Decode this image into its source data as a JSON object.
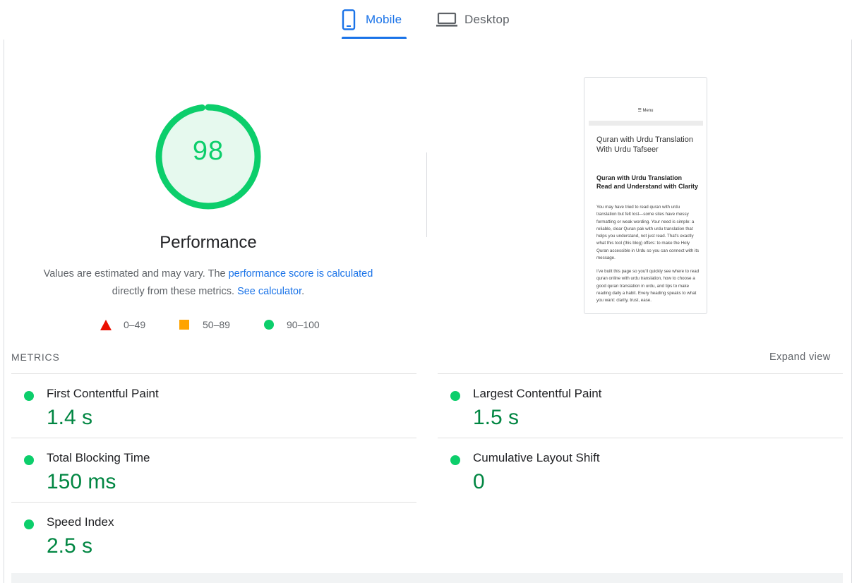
{
  "tabs": [
    {
      "label": "Mobile",
      "active": true
    },
    {
      "label": "Desktop",
      "active": false
    }
  ],
  "score": {
    "value": "98",
    "fraction": 0.98,
    "title": "Performance",
    "desc_text_1": "Values are estimated and may vary. The ",
    "desc_link_1": "performance score is calculated",
    "desc_text_2": "directly from these metrics. ",
    "desc_link_2": "See calculator",
    "desc_text_3": ".",
    "color": "#0cce6b"
  },
  "legend": {
    "fail": "0–49",
    "average": "50–89",
    "pass": "90–100"
  },
  "thumbnail": {
    "menu": "☰ Menu",
    "heading": "Quran with Urdu Translation With Urdu Tafseer",
    "subheading": "Quran with Urdu Translation Read and Understand with Clarity",
    "para1": "You may have tried to read quran with urdu translation but felt lost—some sites have messy formatting or weak wording. Your need is simple: a reliable, clear Quran pak with urdu translation that helps you understand, not just read. That's exactly what this tool (this blog) offers: to make the Holy Quran accessible in Urdu so you can connect with its message.",
    "para2": "I've built this page so you'll quickly see where to read quran online with urdu translation, how to choose a good quran translation in urdu, and tips to make reading daily a habit. Every heading speaks to what you want: clarity, trust, ease."
  },
  "metrics": {
    "title": "METRICS",
    "expand": "Expand view",
    "items": [
      {
        "label": "First Contentful Paint",
        "value": "1.4 s"
      },
      {
        "label": "Largest Contentful Paint",
        "value": "1.5 s"
      },
      {
        "label": "Total Blocking Time",
        "value": "150 ms"
      },
      {
        "label": "Cumulative Layout Shift",
        "value": "0"
      },
      {
        "label": "Speed Index",
        "value": "2.5 s"
      }
    ]
  },
  "colors": {
    "accent": "#1a73e8",
    "pass": "#0cce6b",
    "pass_text": "#018642",
    "average": "#ffa400",
    "fail": "#eb0f00"
  }
}
